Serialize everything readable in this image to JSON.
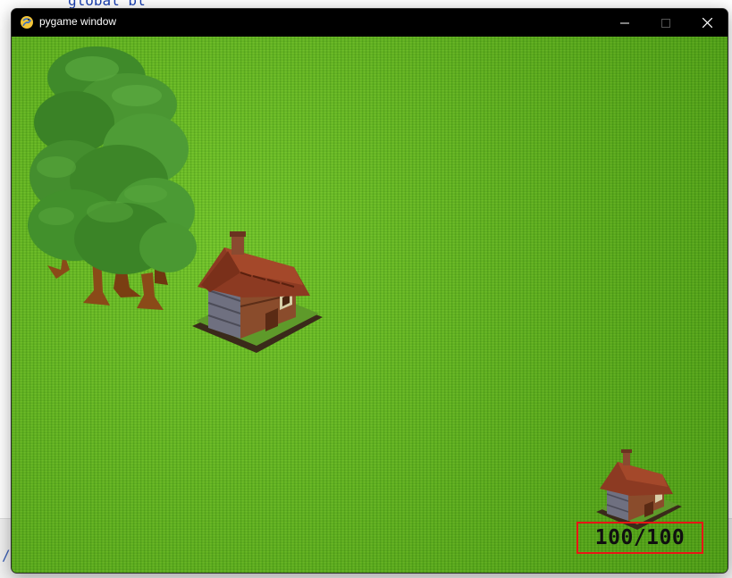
{
  "background": {
    "code_fragment": "global bl",
    "slash_glyph": "/"
  },
  "window": {
    "title": "pygame window",
    "icon": "pygame-snake-icon",
    "controls": {
      "minimize": "minimize-icon",
      "maximize": "maximize-icon",
      "close": "close-icon"
    }
  },
  "game": {
    "grass_color": "#62b51f",
    "sprites": [
      {
        "name": "tree-cluster",
        "icon": "tree-icon"
      },
      {
        "name": "house-large",
        "icon": "house-icon"
      },
      {
        "name": "house-small",
        "icon": "house-icon"
      }
    ],
    "hud": {
      "hp_text": "100/100",
      "hp_current": 100,
      "hp_max": 100,
      "border_color": "#e81515"
    }
  }
}
